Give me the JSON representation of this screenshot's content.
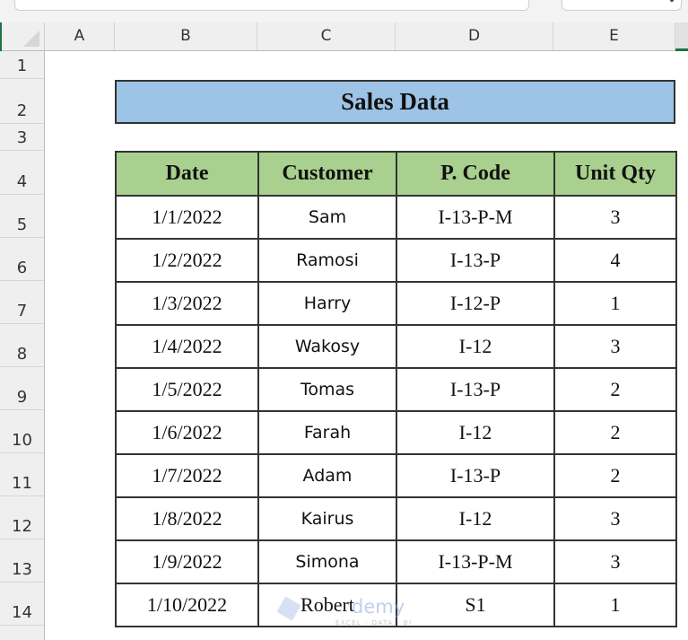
{
  "sheet": {
    "columns": [
      "A",
      "B",
      "C",
      "D",
      "E"
    ],
    "rows": [
      "1",
      "2",
      "3",
      "4",
      "5",
      "6",
      "7",
      "8",
      "9",
      "10",
      "11",
      "12",
      "13",
      "14"
    ]
  },
  "title": "Sales Data",
  "table": {
    "headers": [
      "Date",
      "Customer",
      "P. Code",
      "Unit Qty"
    ],
    "rows": [
      [
        "1/1/2022",
        "Sam",
        "I-13-P-M",
        "3"
      ],
      [
        "1/2/2022",
        "Ramosi",
        "I-13-P",
        "4"
      ],
      [
        "1/3/2022",
        "Harry",
        "I-12-P",
        "1"
      ],
      [
        "1/4/2022",
        "Wakosy",
        "I-12",
        "3"
      ],
      [
        "1/5/2022",
        "Tomas",
        "I-13-P",
        "2"
      ],
      [
        "1/6/2022",
        "Farah",
        "I-12",
        "2"
      ],
      [
        "1/7/2022",
        "Adam",
        "I-13-P",
        "2"
      ],
      [
        "1/8/2022",
        "Kairus",
        "I-12",
        "3"
      ],
      [
        "1/9/2022",
        "Simona",
        "I-13-P-M",
        "3"
      ],
      [
        "1/10/2022",
        "Robert",
        "S1",
        "1"
      ]
    ]
  },
  "colors": {
    "title_fill": "#9dc3e6",
    "header_fill": "#a9d08e",
    "excel_green": "#1e7145"
  },
  "watermark": {
    "text": "exceldemy",
    "visible_text": "demy",
    "subtitle": "EXCEL · DATA · BI"
  }
}
